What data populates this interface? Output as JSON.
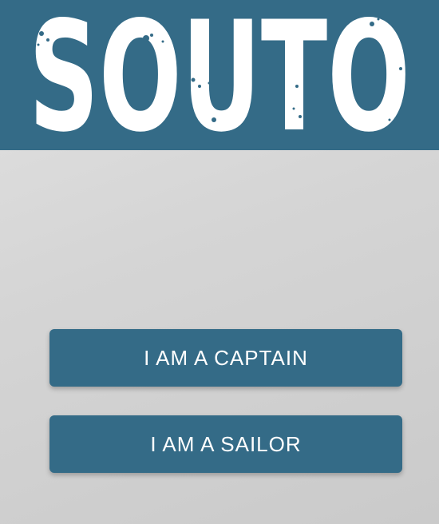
{
  "header": {
    "logo_text": "SOUTO",
    "background_color": "#346b87",
    "logo_color": "#ffffff"
  },
  "actions": {
    "captain_label": "I AM A CAPTAIN",
    "sailor_label": "I AM A SAILOR",
    "button_color": "#346b87",
    "label_color": "#ffffff"
  }
}
